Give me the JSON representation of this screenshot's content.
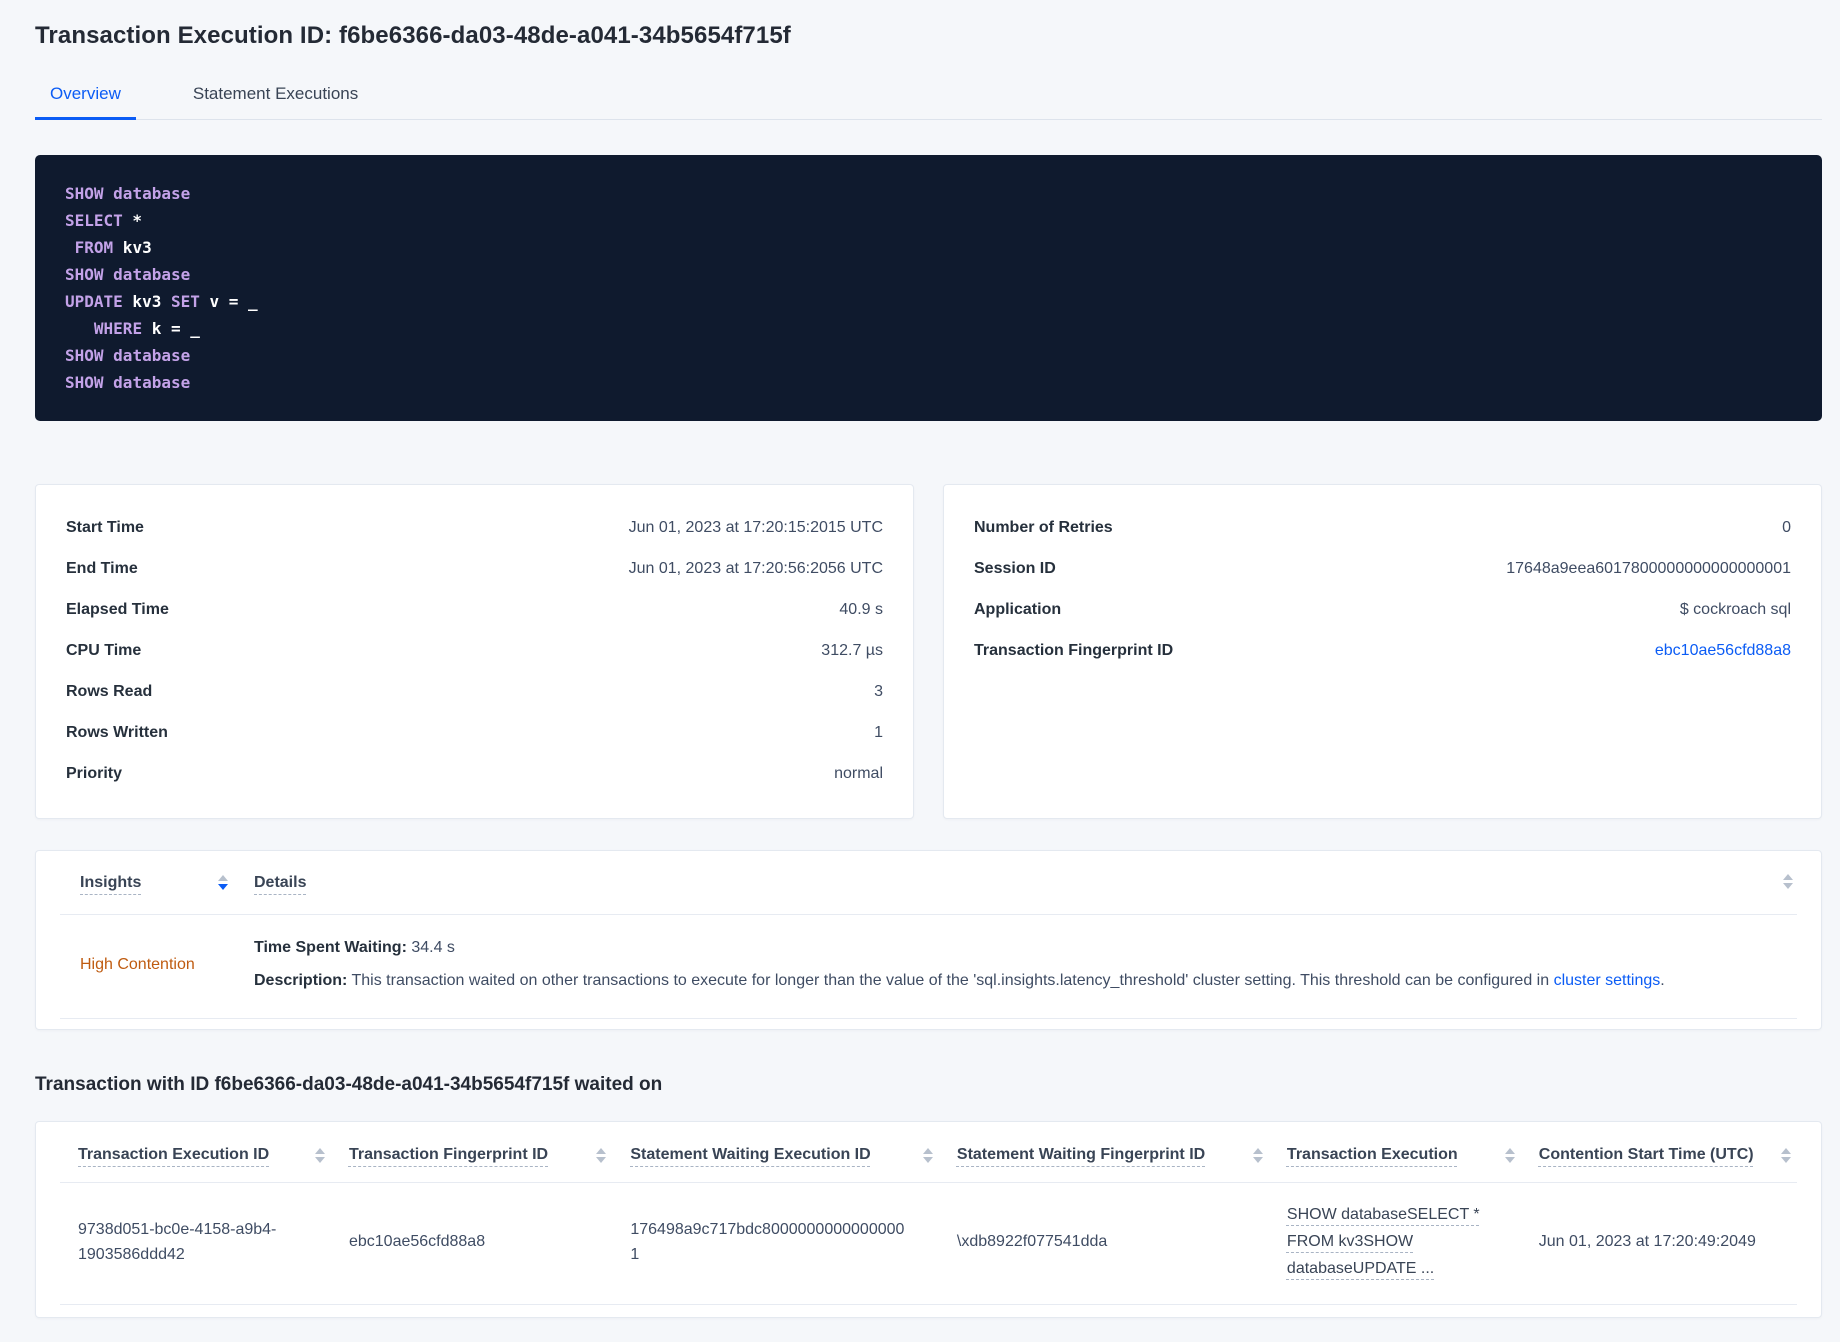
{
  "page": {
    "title": "Transaction Execution ID: f6be6366-da03-48de-a041-34b5654f715f",
    "tabs": [
      {
        "label": "Overview",
        "active": true
      },
      {
        "label": "Statement Executions",
        "active": false
      }
    ]
  },
  "colors": {
    "accent_blue": "#0b5cf5",
    "high_contention_orange": "#bf5b10",
    "sql_keyword_purple": "#c3a2e8",
    "sql_box_background": "#0f1a2e"
  },
  "sql": {
    "lines": [
      [
        [
          "k",
          "SHOW"
        ],
        [
          "t",
          " "
        ],
        [
          "k",
          "database"
        ]
      ],
      [
        [
          "k",
          "SELECT"
        ],
        [
          "t",
          " *"
        ]
      ],
      [
        [
          "t",
          " "
        ],
        [
          "k",
          "FROM"
        ],
        [
          "t",
          " kv3"
        ]
      ],
      [
        [
          "k",
          "SHOW"
        ],
        [
          "t",
          " "
        ],
        [
          "k",
          "database"
        ]
      ],
      [
        [
          "k",
          "UPDATE"
        ],
        [
          "t",
          " kv3 "
        ],
        [
          "k",
          "SET"
        ],
        [
          "t",
          " v = _"
        ]
      ],
      [
        [
          "t",
          "   "
        ],
        [
          "k",
          "WHERE"
        ],
        [
          "t",
          " k = _"
        ]
      ],
      [
        [
          "k",
          "SHOW"
        ],
        [
          "t",
          " "
        ],
        [
          "k",
          "database"
        ]
      ],
      [
        [
          "k",
          "SHOW"
        ],
        [
          "t",
          " "
        ],
        [
          "k",
          "database"
        ]
      ]
    ]
  },
  "left_card": {
    "rows": [
      {
        "label": "Start Time",
        "value": "Jun 01, 2023 at 17:20:15:2015 UTC"
      },
      {
        "label": "End Time",
        "value": "Jun 01, 2023 at 17:20:56:2056 UTC"
      },
      {
        "label": "Elapsed Time",
        "value": "40.9 s"
      },
      {
        "label": "CPU Time",
        "value": "312.7 µs"
      },
      {
        "label": "Rows Read",
        "value": "3"
      },
      {
        "label": "Rows Written",
        "value": "1"
      },
      {
        "label": "Priority",
        "value": "normal"
      }
    ]
  },
  "right_card": {
    "rows": [
      {
        "label": "Number of Retries",
        "value": "0"
      },
      {
        "label": "Session ID",
        "value": "17648a9eea6017800000000000000001"
      },
      {
        "label": "Application",
        "value": "$ cockroach sql"
      },
      {
        "label": "Transaction Fingerprint ID",
        "value": "ebc10ae56cfd88a8"
      }
    ]
  },
  "insights": {
    "columns": [
      {
        "label": "Insights",
        "sorted": "desc"
      },
      {
        "label": "Details"
      }
    ],
    "rows": [
      {
        "insight": "High Contention",
        "waiting_label": "Time Spent Waiting:",
        "waiting_value": " 34.4 s",
        "description_label": "Description:",
        "description_text": " This transaction waited on other transactions to execute for longer than the value of the 'sql.insights.latency_threshold' cluster setting. This threshold can be configured in ",
        "description_link": "cluster settings",
        "description_suffix": "."
      }
    ]
  },
  "waited_on": {
    "title": "Transaction with ID f6be6366-da03-48de-a041-34b5654f715f waited on",
    "columns": [
      "Transaction Execution ID",
      "Transaction Fingerprint ID",
      "Statement Waiting Execution ID",
      "Statement Waiting Fingerprint ID",
      "Transaction Execution",
      "Contention Start Time (UTC)"
    ],
    "rows": [
      {
        "transaction_execution_id": "9738d051-bc0e-4158-a9b4-1903586ddd42",
        "transaction_fingerprint_id": "ebc10ae56cfd88a8",
        "statement_waiting_execution_id": "176498a9c717bdc80000000000000001",
        "statement_waiting_fingerprint_id": "\\xdb8922f077541dda",
        "transaction_execution": "SHOW databaseSELECT * FROM kv3SHOW databaseUPDATE ...",
        "contention_start_time": "Jun 01, 2023 at 17:20:49:2049"
      }
    ]
  }
}
